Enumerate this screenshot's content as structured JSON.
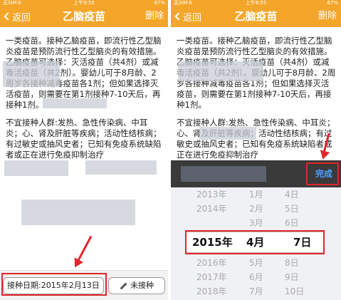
{
  "status_bar": {
    "carrier": "无SIM卡",
    "time": "上午9:55",
    "battery": "67%"
  },
  "nav": {
    "back_label": "返回",
    "title": "乙脑疫苗",
    "delete_label": "删除"
  },
  "content": {
    "p1": "一类疫苗。接种乙脑疫苗，即流行性乙型脑炎疫苗是预防流行性乙型脑炎的有效措施。乙脑疫苗可选择：灭活疫苗（共4剂）或减毒活疫苗（共2剂）。婴幼儿可于8月龄、2周岁各接种减毒疫苗各1剂；但如果选择灭活疫苗，则需要在第1剂接种7-10天后，再接种1剂。",
    "p2": "不宜接种人群:发热、急性传染病、中耳炎；心、肾及肝脏等疾病；活动性结核病；有过敏史或抽风史者；已知有免疫系统缺陷者或正在进行免疫抑制治疗"
  },
  "bottom_bar": {
    "date_label": "接种日期:2015年2月13日",
    "unvaccinated_label": "未接种"
  },
  "picker_toolbar": {
    "done_label": "完成"
  },
  "picker": {
    "rows_above": [
      {
        "year": "2013年",
        "month": "1月",
        "day": "4日"
      },
      {
        "year": "2014年",
        "month": "2月",
        "day": "5日"
      },
      {
        "year": "",
        "month": "3月",
        "day": "6日"
      }
    ],
    "selected": {
      "year": "2015年",
      "month": "4月",
      "day": "7日"
    },
    "rows_below": [
      {
        "year": "2016年",
        "month": "5月",
        "day": "8日"
      },
      {
        "year": "2017年",
        "month": "6月",
        "day": "9日"
      },
      {
        "year": "2018年",
        "month": "7月",
        "day": "10日"
      }
    ]
  },
  "colors": {
    "nav_bg": "#f4a62a",
    "annotation_red": "#e0262c",
    "done_blue": "#4aa3ff"
  }
}
